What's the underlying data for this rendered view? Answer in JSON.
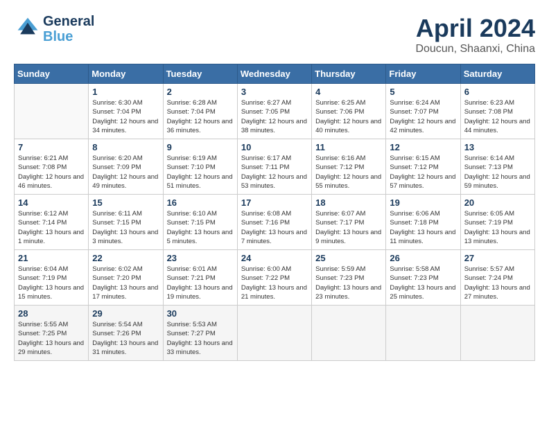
{
  "header": {
    "logo_general": "General",
    "logo_blue": "Blue",
    "title": "April 2024",
    "location": "Doucun, Shaanxi, China"
  },
  "weekdays": [
    "Sunday",
    "Monday",
    "Tuesday",
    "Wednesday",
    "Thursday",
    "Friday",
    "Saturday"
  ],
  "weeks": [
    [
      {
        "day": "",
        "sunrise": "",
        "sunset": "",
        "daylight": ""
      },
      {
        "day": "1",
        "sunrise": "6:30 AM",
        "sunset": "7:04 PM",
        "daylight": "12 hours and 34 minutes."
      },
      {
        "day": "2",
        "sunrise": "6:28 AM",
        "sunset": "7:04 PM",
        "daylight": "12 hours and 36 minutes."
      },
      {
        "day": "3",
        "sunrise": "6:27 AM",
        "sunset": "7:05 PM",
        "daylight": "12 hours and 38 minutes."
      },
      {
        "day": "4",
        "sunrise": "6:25 AM",
        "sunset": "7:06 PM",
        "daylight": "12 hours and 40 minutes."
      },
      {
        "day": "5",
        "sunrise": "6:24 AM",
        "sunset": "7:07 PM",
        "daylight": "12 hours and 42 minutes."
      },
      {
        "day": "6",
        "sunrise": "6:23 AM",
        "sunset": "7:08 PM",
        "daylight": "12 hours and 44 minutes."
      }
    ],
    [
      {
        "day": "7",
        "sunrise": "6:21 AM",
        "sunset": "7:08 PM",
        "daylight": "12 hours and 46 minutes."
      },
      {
        "day": "8",
        "sunrise": "6:20 AM",
        "sunset": "7:09 PM",
        "daylight": "12 hours and 49 minutes."
      },
      {
        "day": "9",
        "sunrise": "6:19 AM",
        "sunset": "7:10 PM",
        "daylight": "12 hours and 51 minutes."
      },
      {
        "day": "10",
        "sunrise": "6:17 AM",
        "sunset": "7:11 PM",
        "daylight": "12 hours and 53 minutes."
      },
      {
        "day": "11",
        "sunrise": "6:16 AM",
        "sunset": "7:12 PM",
        "daylight": "12 hours and 55 minutes."
      },
      {
        "day": "12",
        "sunrise": "6:15 AM",
        "sunset": "7:12 PM",
        "daylight": "12 hours and 57 minutes."
      },
      {
        "day": "13",
        "sunrise": "6:14 AM",
        "sunset": "7:13 PM",
        "daylight": "12 hours and 59 minutes."
      }
    ],
    [
      {
        "day": "14",
        "sunrise": "6:12 AM",
        "sunset": "7:14 PM",
        "daylight": "13 hours and 1 minute."
      },
      {
        "day": "15",
        "sunrise": "6:11 AM",
        "sunset": "7:15 PM",
        "daylight": "13 hours and 3 minutes."
      },
      {
        "day": "16",
        "sunrise": "6:10 AM",
        "sunset": "7:15 PM",
        "daylight": "13 hours and 5 minutes."
      },
      {
        "day": "17",
        "sunrise": "6:08 AM",
        "sunset": "7:16 PM",
        "daylight": "13 hours and 7 minutes."
      },
      {
        "day": "18",
        "sunrise": "6:07 AM",
        "sunset": "7:17 PM",
        "daylight": "13 hours and 9 minutes."
      },
      {
        "day": "19",
        "sunrise": "6:06 AM",
        "sunset": "7:18 PM",
        "daylight": "13 hours and 11 minutes."
      },
      {
        "day": "20",
        "sunrise": "6:05 AM",
        "sunset": "7:19 PM",
        "daylight": "13 hours and 13 minutes."
      }
    ],
    [
      {
        "day": "21",
        "sunrise": "6:04 AM",
        "sunset": "7:19 PM",
        "daylight": "13 hours and 15 minutes."
      },
      {
        "day": "22",
        "sunrise": "6:02 AM",
        "sunset": "7:20 PM",
        "daylight": "13 hours and 17 minutes."
      },
      {
        "day": "23",
        "sunrise": "6:01 AM",
        "sunset": "7:21 PM",
        "daylight": "13 hours and 19 minutes."
      },
      {
        "day": "24",
        "sunrise": "6:00 AM",
        "sunset": "7:22 PM",
        "daylight": "13 hours and 21 minutes."
      },
      {
        "day": "25",
        "sunrise": "5:59 AM",
        "sunset": "7:23 PM",
        "daylight": "13 hours and 23 minutes."
      },
      {
        "day": "26",
        "sunrise": "5:58 AM",
        "sunset": "7:23 PM",
        "daylight": "13 hours and 25 minutes."
      },
      {
        "day": "27",
        "sunrise": "5:57 AM",
        "sunset": "7:24 PM",
        "daylight": "13 hours and 27 minutes."
      }
    ],
    [
      {
        "day": "28",
        "sunrise": "5:55 AM",
        "sunset": "7:25 PM",
        "daylight": "13 hours and 29 minutes."
      },
      {
        "day": "29",
        "sunrise": "5:54 AM",
        "sunset": "7:26 PM",
        "daylight": "13 hours and 31 minutes."
      },
      {
        "day": "30",
        "sunrise": "5:53 AM",
        "sunset": "7:27 PM",
        "daylight": "13 hours and 33 minutes."
      },
      {
        "day": "",
        "sunrise": "",
        "sunset": "",
        "daylight": ""
      },
      {
        "day": "",
        "sunrise": "",
        "sunset": "",
        "daylight": ""
      },
      {
        "day": "",
        "sunrise": "",
        "sunset": "",
        "daylight": ""
      },
      {
        "day": "",
        "sunrise": "",
        "sunset": "",
        "daylight": ""
      }
    ]
  ]
}
